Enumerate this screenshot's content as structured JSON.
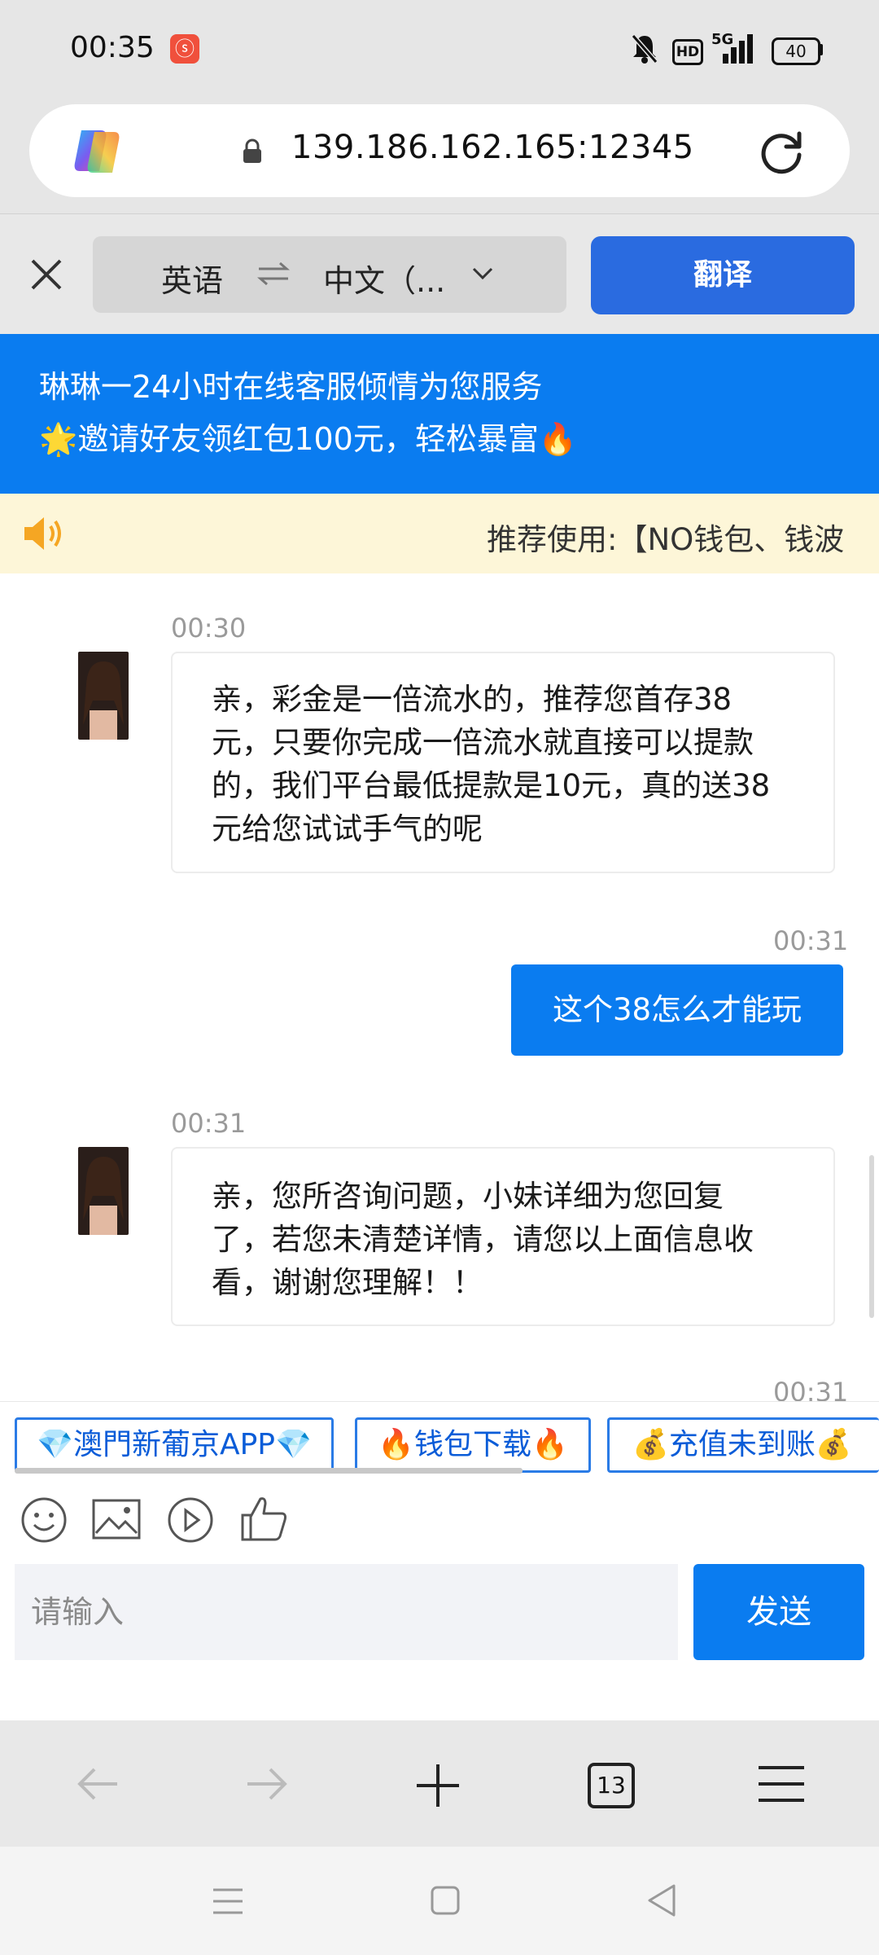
{
  "status": {
    "time": "00:35",
    "battery": "40",
    "hd": "HD",
    "net": "5G"
  },
  "browser": {
    "url": "139.186.162.165:12345",
    "tab_count": "13"
  },
  "translate": {
    "source_lang": "英语",
    "target_lang": "中文（...",
    "button": "翻译"
  },
  "banner": {
    "line1": "琳琳一24小时在线客服倾情为您服务",
    "line2": "🌟邀请好友领红包100元，轻松暴富🔥"
  },
  "notice": {
    "text": "推荐使用:【NO钱包、钱波"
  },
  "chat": {
    "messages": [
      {
        "time": "00:30",
        "lines": [
          "亲，彩金是一倍流水的，推荐您首存38",
          "元，只要你完成一倍流水就直接可以提款",
          "的，我们平台最低提款是10元，真的送38",
          "元给您试试手气的呢"
        ]
      },
      {
        "time": "00:31",
        "text": "这个38怎么才能玩"
      },
      {
        "time": "00:31",
        "lines": [
          "亲，您所咨询问题，小妹详细为您回复",
          "了，若您未清楚详情，请您以上面信息收",
          "看，谢谢您理解！！"
        ]
      },
      {
        "time": "00:31"
      }
    ]
  },
  "quick_replies": [
    "💎澳門新葡京APP💎",
    "🔥钱包下载🔥",
    "💰充值未到账💰"
  ],
  "composer": {
    "placeholder": "请输入",
    "send": "发送"
  },
  "colors": {
    "primary": "#0a7cf0",
    "translate": "#2a6be0",
    "notice_bg": "#fdf6d8"
  }
}
